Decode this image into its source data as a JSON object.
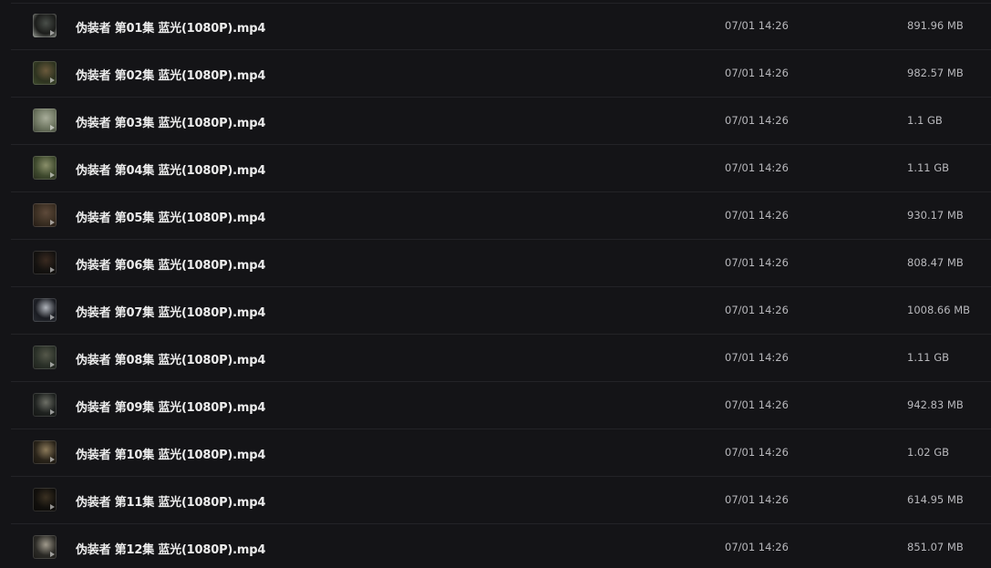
{
  "files": [
    {
      "name": "伪装者 第01集 蓝光(1080P).mp4",
      "modified": "07/01 14:26",
      "size": "891.96 MB",
      "thumb_colors": [
        "#1b1c1a",
        "#4a4f4a",
        "#9fa49c"
      ]
    },
    {
      "name": "伪装者 第02集 蓝光(1080P).mp4",
      "modified": "07/01 14:26",
      "size": "982.57 MB",
      "thumb_colors": [
        "#2e3320",
        "#6b5a3c",
        "#3d4a2c"
      ]
    },
    {
      "name": "伪装者 第03集 蓝光(1080P).mp4",
      "modified": "07/01 14:26",
      "size": "1.1 GB",
      "thumb_colors": [
        "#6d7560",
        "#a8ad9a",
        "#3e4436"
      ]
    },
    {
      "name": "伪装者 第04集 蓝光(1080P).mp4",
      "modified": "07/01 14:26",
      "size": "1.11 GB",
      "thumb_colors": [
        "#3f4a2e",
        "#8a8f6a",
        "#262b1c"
      ]
    },
    {
      "name": "伪装者 第05集 蓝光(1080P).mp4",
      "modified": "07/01 14:26",
      "size": "930.17 MB",
      "thumb_colors": [
        "#3a2e22",
        "#5e4a3a",
        "#201812"
      ]
    },
    {
      "name": "伪装者 第06集 蓝光(1080P).mp4",
      "modified": "07/01 14:26",
      "size": "808.47 MB",
      "thumb_colors": [
        "#141210",
        "#3a2a20",
        "#0c0b0a"
      ]
    },
    {
      "name": "伪装者 第07集 蓝光(1080P).mp4",
      "modified": "07/01 14:26",
      "size": "1008.66 MB",
      "thumb_colors": [
        "#1a1c22",
        "#b0b4bb",
        "#2a2d33"
      ]
    },
    {
      "name": "伪装者 第08集 蓝光(1080P).mp4",
      "modified": "07/01 14:26",
      "size": "1.11 GB",
      "thumb_colors": [
        "#2a3028",
        "#55584a",
        "#1c1f1a"
      ]
    },
    {
      "name": "伪装者 第09集 蓝光(1080P).mp4",
      "modified": "07/01 14:26",
      "size": "942.83 MB",
      "thumb_colors": [
        "#1f2220",
        "#6d6f66",
        "#121412"
      ]
    },
    {
      "name": "伪装者 第10集 蓝光(1080P).mp4",
      "modified": "07/01 14:26",
      "size": "1.02 GB",
      "thumb_colors": [
        "#2a241a",
        "#8c7a5a",
        "#15120d"
      ]
    },
    {
      "name": "伪装者 第11集 蓝光(1080P).mp4",
      "modified": "07/01 14:26",
      "size": "614.95 MB",
      "thumb_colors": [
        "#110f0c",
        "#3b3122",
        "#0a0907"
      ]
    },
    {
      "name": "伪装者 第12集 蓝光(1080P).mp4",
      "modified": "07/01 14:26",
      "size": "851.07 MB",
      "thumb_colors": [
        "#2b2a26",
        "#a09a8c",
        "#1a1916"
      ]
    }
  ]
}
